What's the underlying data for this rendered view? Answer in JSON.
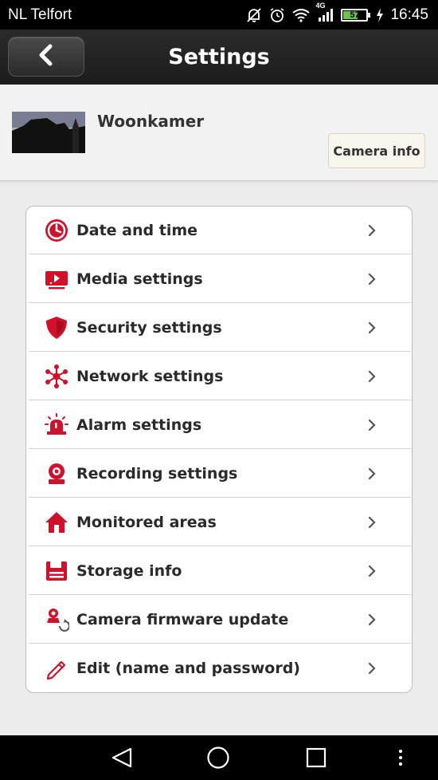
{
  "status_bar": {
    "carrier": "NL Telfort",
    "network_type": "4G",
    "battery_level": "57",
    "time": "16:45",
    "icons": [
      "mute-icon",
      "alarm-icon",
      "wifi-icon",
      "signal-icon",
      "battery-icon",
      "charging-icon"
    ]
  },
  "header": {
    "title": "Settings",
    "back_icon": "chevron-left-icon"
  },
  "camera": {
    "name": "Woonkamer",
    "info_button_label": "Camera info"
  },
  "menu": {
    "items": [
      {
        "label": "Date and time",
        "icon": "clock-icon"
      },
      {
        "label": "Media settings",
        "icon": "media-icon"
      },
      {
        "label": "Security settings",
        "icon": "shield-icon"
      },
      {
        "label": "Network settings",
        "icon": "network-icon"
      },
      {
        "label": "Alarm settings",
        "icon": "alarm-siren-icon"
      },
      {
        "label": "Recording settings",
        "icon": "camera-icon"
      },
      {
        "label": "Monitored areas",
        "icon": "house-icon"
      },
      {
        "label": "Storage info",
        "icon": "storage-icon"
      },
      {
        "label": "Camera firmware update",
        "icon": "firmware-update-icon"
      },
      {
        "label": "Edit (name and password)",
        "icon": "pencil-icon"
      }
    ]
  },
  "nav_bar": {
    "icons": [
      "back-triangle-icon",
      "home-circle-icon",
      "recents-square-icon",
      "more-dots-icon"
    ]
  },
  "colors": {
    "accent_red": "#d0112b",
    "status_bar_bg": "#000000",
    "title_bar_bg": "#232323"
  }
}
